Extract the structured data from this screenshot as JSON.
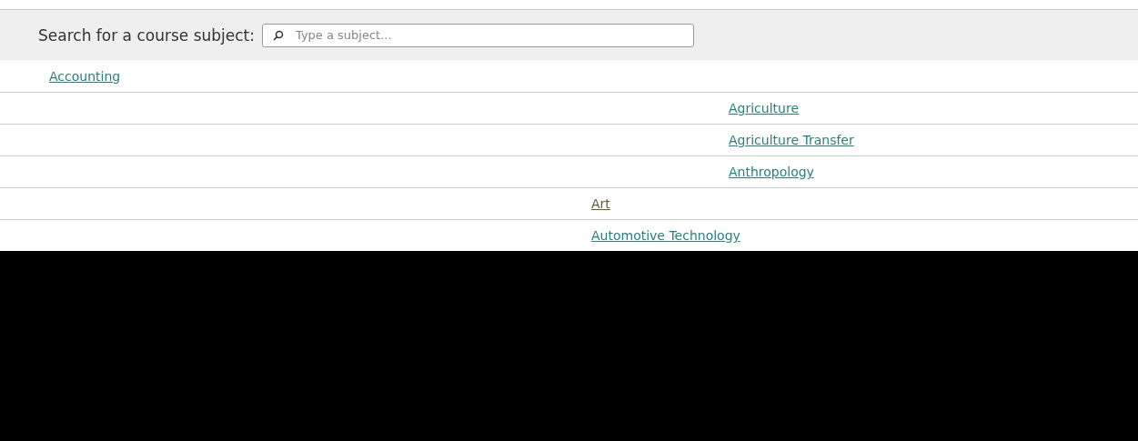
{
  "search": {
    "label": "Search for a course subject:",
    "placeholder": "Type a subject..."
  },
  "subject_groups": [
    [
      {
        "name": "Accounting",
        "visited": false
      },
      {
        "name": "Agriculture",
        "visited": false
      },
      {
        "name": "Agriculture Transfer",
        "visited": false
      },
      {
        "name": "Anthropology",
        "visited": false
      }
    ],
    [
      {
        "name": "Art",
        "visited": true
      },
      {
        "name": "Automotive Technology",
        "visited": false
      }
    ]
  ]
}
